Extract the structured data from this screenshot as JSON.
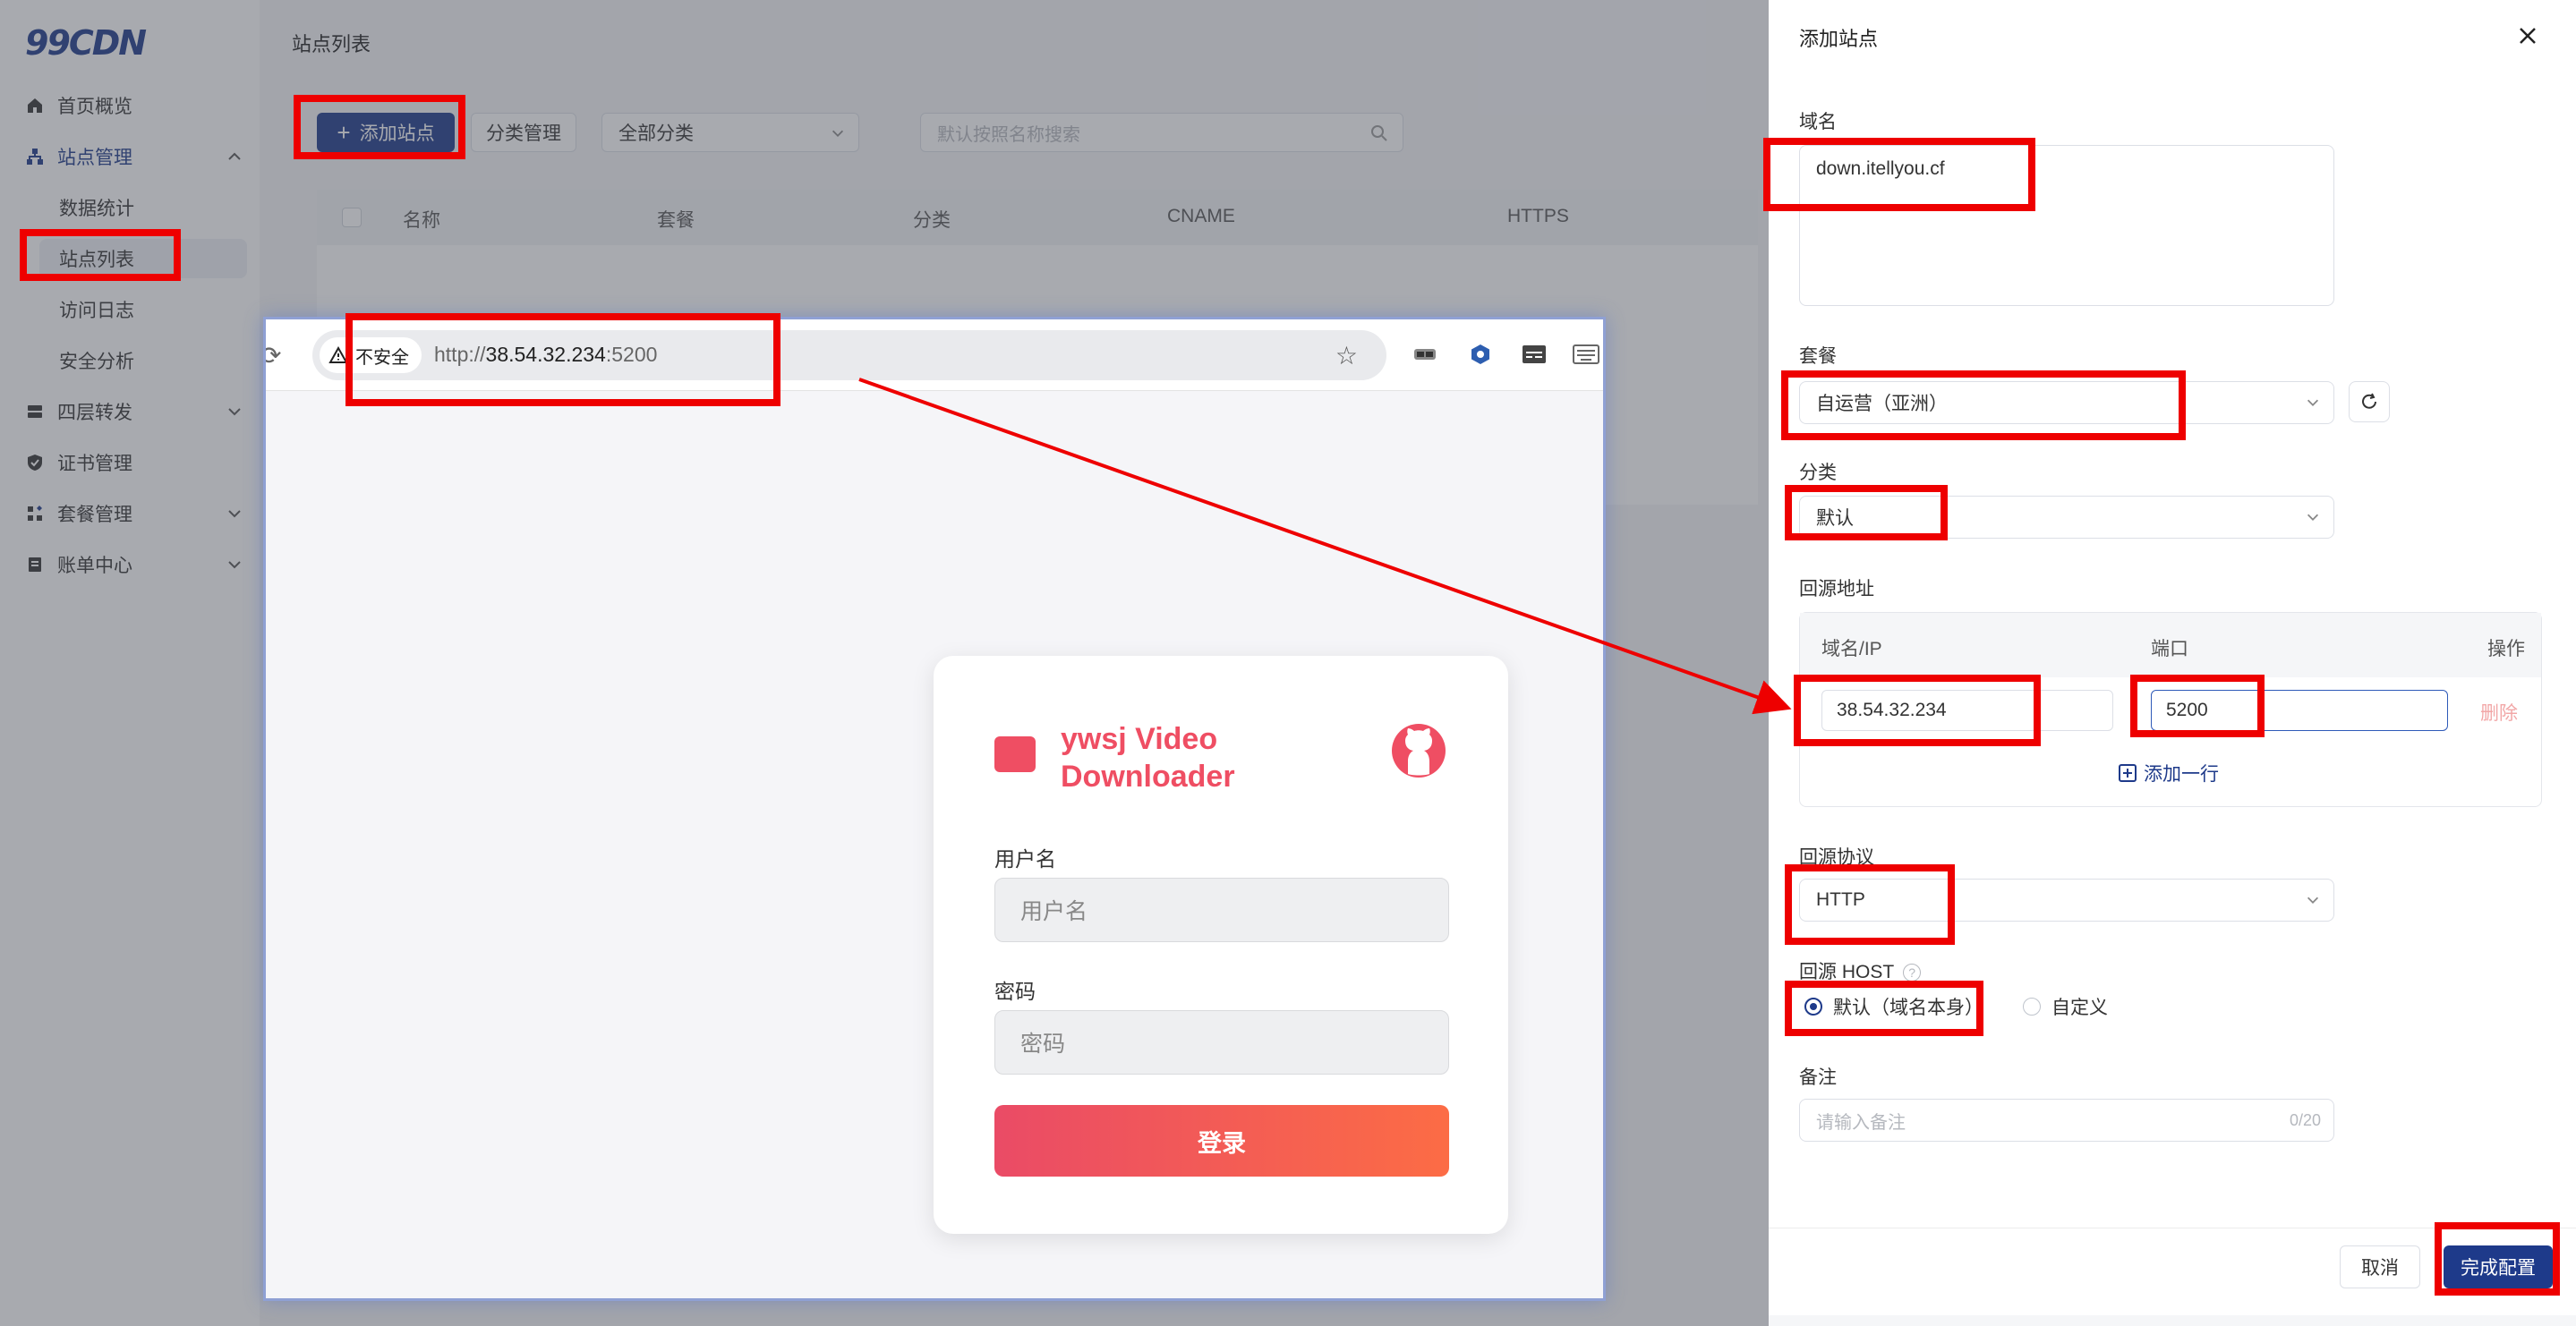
{
  "sidebar": {
    "logo": "99CDN",
    "items": [
      {
        "label": "首页概览"
      },
      {
        "label": "站点管理"
      },
      {
        "label": "四层转发"
      },
      {
        "label": "证书管理"
      },
      {
        "label": "套餐管理"
      },
      {
        "label": "账单中心"
      }
    ],
    "sub_items": [
      {
        "label": "数据统计"
      },
      {
        "label": "站点列表"
      },
      {
        "label": "访问日志"
      },
      {
        "label": "安全分析"
      }
    ]
  },
  "main": {
    "title": "站点列表",
    "add_site_label": "添加站点",
    "category_mgmt_label": "分类管理",
    "category_select": "全部分类",
    "search_placeholder": "默认按照名称搜索",
    "table_headers": [
      "名称",
      "套餐",
      "分类",
      "CNAME",
      "HTTPS"
    ]
  },
  "browser": {
    "insecure_label": "不安全",
    "url_scheme": "http://",
    "url_host": "38.54.32.234",
    "url_port": ":5200",
    "login": {
      "title": "ywsj Video Downloader",
      "username_label": "用户名",
      "username_placeholder": "用户名",
      "password_label": "密码",
      "password_placeholder": "密码",
      "login_button": "登录"
    }
  },
  "drawer": {
    "title": "添加站点",
    "domain_label": "域名",
    "domain_value": "down.itellyou.cf",
    "plan_label": "套餐",
    "plan_value": "自运营（亚洲）",
    "category_label": "分类",
    "category_value": "默认",
    "origin_label": "回源地址",
    "origin_headers": [
      "域名/IP",
      "端口",
      "操作"
    ],
    "origin_ip": "38.54.32.234",
    "origin_port": "5200",
    "delete_label": "删除",
    "add_row_label": "添加一行",
    "protocol_label": "回源协议",
    "protocol_value": "HTTP",
    "host_label": "回源 HOST",
    "host_default": "默认（域名本身）",
    "host_custom": "自定义",
    "remark_label": "备注",
    "remark_placeholder": "请输入备注",
    "remark_count": "0/20",
    "cancel_label": "取消",
    "done_label": "完成配置"
  },
  "colors": {
    "brand": "#1e3a8a",
    "annotation": "#ee0000",
    "login_accent": "#ef4e63"
  }
}
